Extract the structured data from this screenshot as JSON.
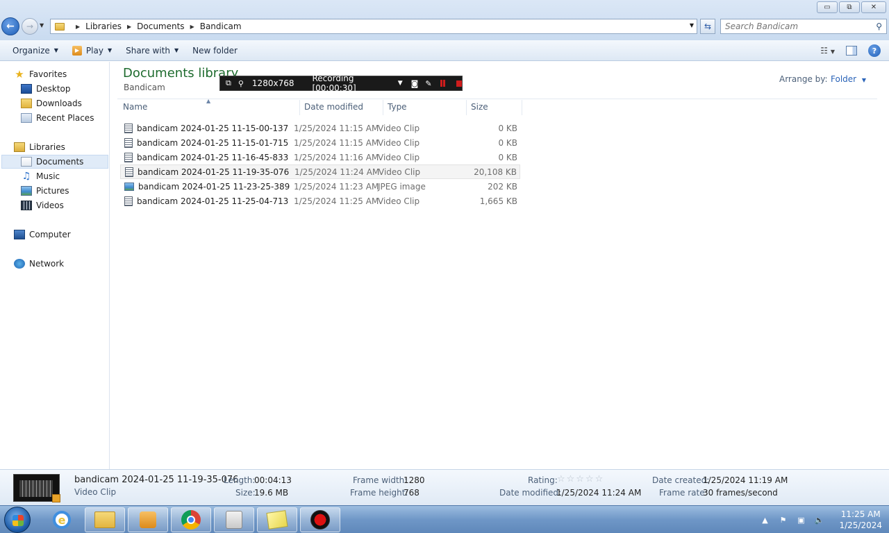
{
  "window": {
    "minimize_glyph": "▭",
    "maximize_glyph": "⧉",
    "close_glyph": "✕"
  },
  "address": {
    "crumbs": [
      "Libraries",
      "Documents",
      "Bandicam"
    ],
    "search_placeholder": "Search Bandicam"
  },
  "toolbar": {
    "organize": "Organize",
    "play": "Play",
    "share_with": "Share with",
    "new_folder": "New folder"
  },
  "sidebar": {
    "favorites": "Favorites",
    "desktop": "Desktop",
    "downloads": "Downloads",
    "recent_places": "Recent Places",
    "libraries": "Libraries",
    "documents": "Documents",
    "music": "Music",
    "pictures": "Pictures",
    "videos": "Videos",
    "computer": "Computer",
    "network": "Network"
  },
  "main": {
    "title": "Documents library",
    "subtitle": "Bandicam",
    "arrange_by_label": "Arrange by:",
    "arrange_by_value": "Folder",
    "columns": {
      "name": "Name",
      "date_modified": "Date modified",
      "type": "Type",
      "size": "Size"
    },
    "files": [
      {
        "name": "bandicam 2024-01-25 11-15-00-137",
        "date": "1/25/2024 11:15 AM",
        "type": "Video Clip",
        "size": "0 KB"
      },
      {
        "name": "bandicam 2024-01-25 11-15-01-715",
        "date": "1/25/2024 11:15 AM",
        "type": "Video Clip",
        "size": "0 KB"
      },
      {
        "name": "bandicam 2024-01-25 11-16-45-833",
        "date": "1/25/2024 11:16 AM",
        "type": "Video Clip",
        "size": "0 KB"
      },
      {
        "name": "bandicam 2024-01-25 11-19-35-076",
        "date": "1/25/2024 11:24 AM",
        "type": "Video Clip",
        "size": "20,108 KB"
      },
      {
        "name": "bandicam 2024-01-25 11-23-25-389",
        "date": "1/25/2024 11:23 AM",
        "type": "JPEG image",
        "size": "202 KB"
      },
      {
        "name": "bandicam 2024-01-25 11-25-04-713",
        "date": "1/25/2024 11:25 AM",
        "type": "Video Clip",
        "size": "1,665 KB"
      }
    ]
  },
  "recording_bar": {
    "resolution": "1280x768",
    "status": "Recording [00:00:30]"
  },
  "details": {
    "name": "bandicam 2024-01-25 11-19-35-076",
    "kind": "Video Clip",
    "length_label": "Length:",
    "length_value": "00:04:13",
    "size_label": "Size:",
    "size_value": "19.6 MB",
    "frame_width_label": "Frame width:",
    "frame_width_value": "1280",
    "frame_height_label": "Frame height:",
    "frame_height_value": "768",
    "rating_label": "Rating:",
    "rating_stars": "☆☆☆☆☆",
    "date_modified_label": "Date modified:",
    "date_modified_value": "1/25/2024 11:24 AM",
    "date_created_label": "Date created:",
    "date_created_value": "1/25/2024 11:19 AM",
    "frame_rate_label": "Frame rate:",
    "frame_rate_value": "30 frames/second"
  },
  "taskbar": {
    "time": "11:25 AM",
    "date": "1/25/2024"
  }
}
